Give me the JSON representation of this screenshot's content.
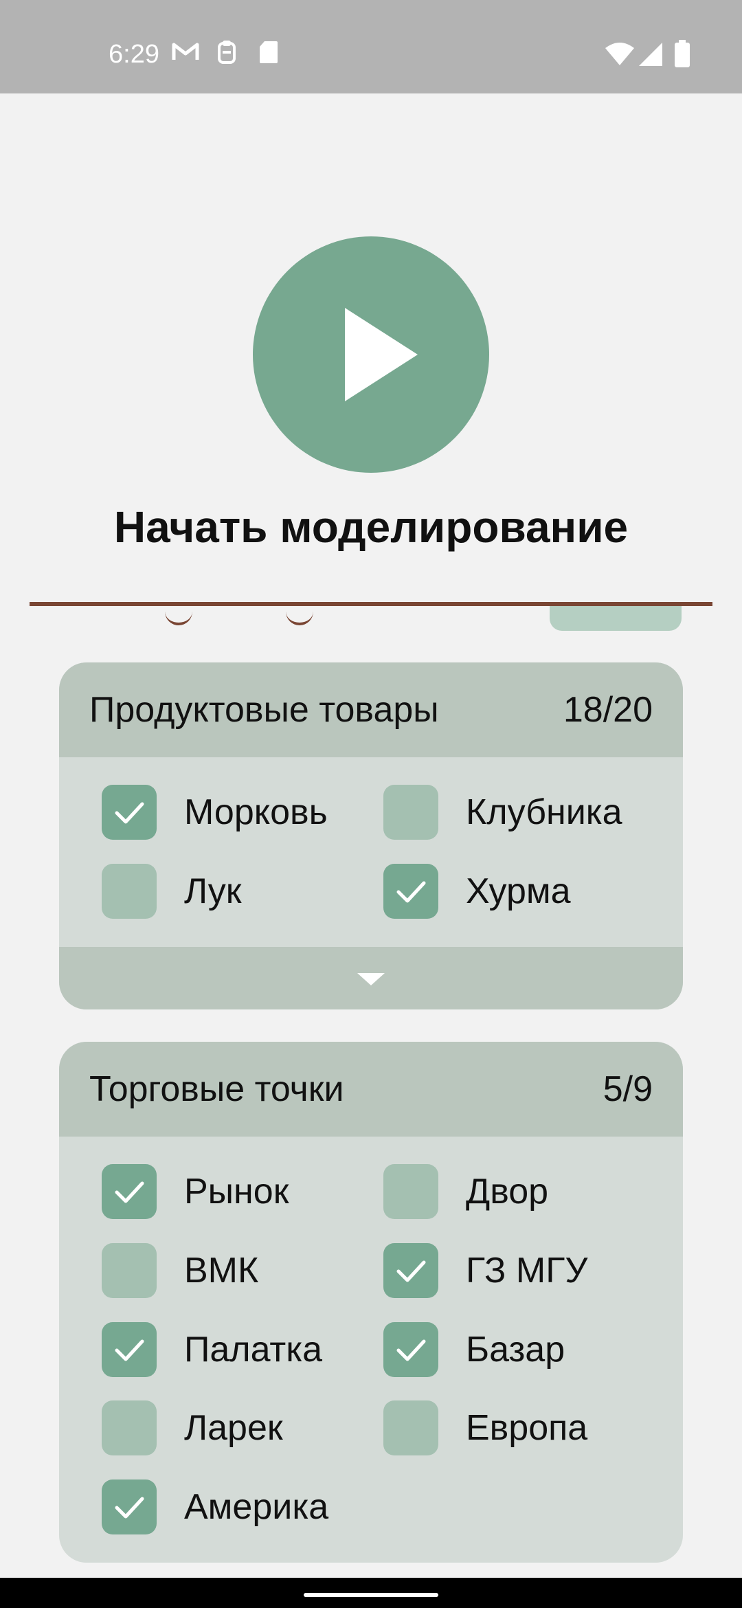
{
  "status_bar": {
    "time": "6:29",
    "left_icons": [
      "gmail-icon",
      "clipboard-icon",
      "sd-card-icon"
    ],
    "right_icons": [
      "wifi-icon",
      "signal-icon",
      "battery-icon"
    ]
  },
  "play_button": {
    "icon": "play-icon",
    "color": "#77a890"
  },
  "start_title": "Начать моделирование",
  "products": {
    "title": "Продуктовые товары",
    "count": "18/20",
    "items": [
      {
        "label": "Морковь",
        "checked": true
      },
      {
        "label": "Клубника",
        "checked": false
      },
      {
        "label": "Лук",
        "checked": false
      },
      {
        "label": "Хурма",
        "checked": true
      }
    ],
    "expand_icon": "chevron-down-icon"
  },
  "outlets": {
    "title": "Торговые точки",
    "count": "5/9",
    "items": [
      {
        "label": "Рынок",
        "checked": true
      },
      {
        "label": "Двор",
        "checked": false
      },
      {
        "label": "ВМК",
        "checked": false
      },
      {
        "label": "ГЗ МГУ",
        "checked": true
      },
      {
        "label": "Палатка",
        "checked": true
      },
      {
        "label": "Базар",
        "checked": true
      },
      {
        "label": "Ларек",
        "checked": false
      },
      {
        "label": "Европа",
        "checked": false
      },
      {
        "label": "Америка",
        "checked": true
      }
    ]
  },
  "colors": {
    "accent": "#77a890",
    "divider": "#7a4634",
    "card_bg": "#d4dbd7",
    "card_header": "#bac6bd",
    "checkbox_off": "#a4c0b1"
  }
}
